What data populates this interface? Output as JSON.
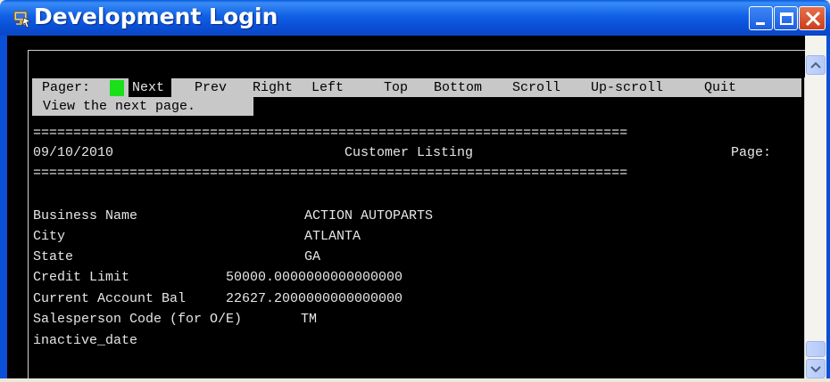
{
  "window": {
    "title": "Development Login"
  },
  "menu": {
    "pager_label": "Pager:",
    "items": [
      "Next",
      "Prev",
      "Right",
      "Left",
      "Top",
      "Bottom",
      "Scroll",
      "Up-scroll",
      "Quit"
    ],
    "hint": "View the next page."
  },
  "report": {
    "rule": "==========================================================================",
    "date": "09/10/2010",
    "title": "Customer Listing",
    "page_label": "Page:",
    "fields": [
      {
        "label": "Business Name",
        "value": "ACTION AUTOPARTS"
      },
      {
        "label": "City",
        "value": "ATLANTA"
      },
      {
        "label": "State",
        "value": "GA"
      },
      {
        "label": "Credit Limit",
        "value": "50000.0000000000000000"
      },
      {
        "label": "Current Account Bal",
        "value": "22627.2000000000000000"
      },
      {
        "label": "Salesperson Code (for O/E)",
        "value": "TM"
      },
      {
        "label": "inactive_date",
        "value": ""
      }
    ]
  },
  "colors": {
    "titlebar": "#0a50d8",
    "menu_bg": "#c8c8c8",
    "cursor": "#19e019",
    "console_bg": "#000000"
  }
}
